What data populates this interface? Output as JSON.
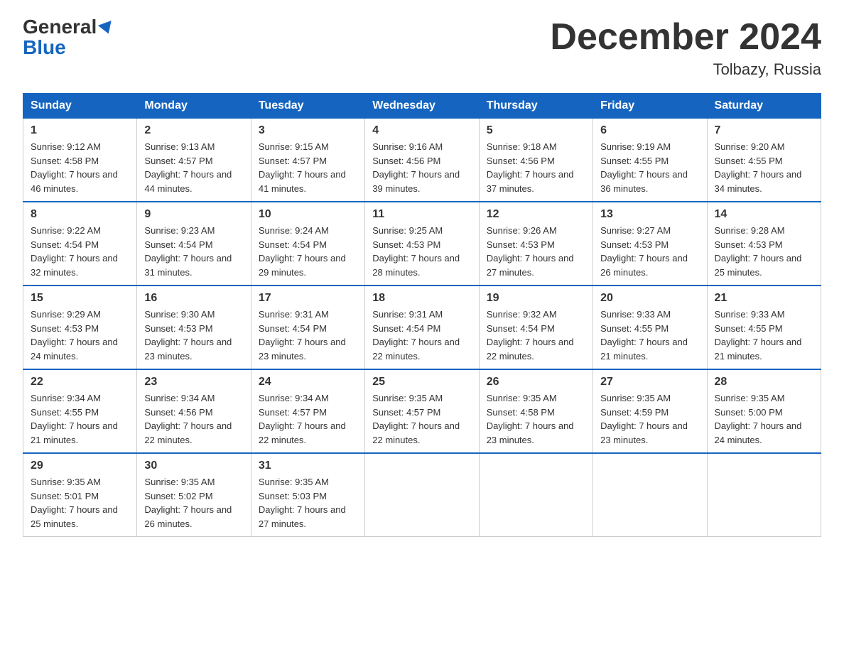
{
  "logo": {
    "line1": "General",
    "line2": "Blue"
  },
  "title": "December 2024",
  "subtitle": "Tolbazy, Russia",
  "weekdays": [
    "Sunday",
    "Monday",
    "Tuesday",
    "Wednesday",
    "Thursday",
    "Friday",
    "Saturday"
  ],
  "weeks": [
    [
      {
        "day": "1",
        "sunrise": "9:12 AM",
        "sunset": "4:58 PM",
        "daylight": "7 hours and 46 minutes."
      },
      {
        "day": "2",
        "sunrise": "9:13 AM",
        "sunset": "4:57 PM",
        "daylight": "7 hours and 44 minutes."
      },
      {
        "day": "3",
        "sunrise": "9:15 AM",
        "sunset": "4:57 PM",
        "daylight": "7 hours and 41 minutes."
      },
      {
        "day": "4",
        "sunrise": "9:16 AM",
        "sunset": "4:56 PM",
        "daylight": "7 hours and 39 minutes."
      },
      {
        "day": "5",
        "sunrise": "9:18 AM",
        "sunset": "4:56 PM",
        "daylight": "7 hours and 37 minutes."
      },
      {
        "day": "6",
        "sunrise": "9:19 AM",
        "sunset": "4:55 PM",
        "daylight": "7 hours and 36 minutes."
      },
      {
        "day": "7",
        "sunrise": "9:20 AM",
        "sunset": "4:55 PM",
        "daylight": "7 hours and 34 minutes."
      }
    ],
    [
      {
        "day": "8",
        "sunrise": "9:22 AM",
        "sunset": "4:54 PM",
        "daylight": "7 hours and 32 minutes."
      },
      {
        "day": "9",
        "sunrise": "9:23 AM",
        "sunset": "4:54 PM",
        "daylight": "7 hours and 31 minutes."
      },
      {
        "day": "10",
        "sunrise": "9:24 AM",
        "sunset": "4:54 PM",
        "daylight": "7 hours and 29 minutes."
      },
      {
        "day": "11",
        "sunrise": "9:25 AM",
        "sunset": "4:53 PM",
        "daylight": "7 hours and 28 minutes."
      },
      {
        "day": "12",
        "sunrise": "9:26 AM",
        "sunset": "4:53 PM",
        "daylight": "7 hours and 27 minutes."
      },
      {
        "day": "13",
        "sunrise": "9:27 AM",
        "sunset": "4:53 PM",
        "daylight": "7 hours and 26 minutes."
      },
      {
        "day": "14",
        "sunrise": "9:28 AM",
        "sunset": "4:53 PM",
        "daylight": "7 hours and 25 minutes."
      }
    ],
    [
      {
        "day": "15",
        "sunrise": "9:29 AM",
        "sunset": "4:53 PM",
        "daylight": "7 hours and 24 minutes."
      },
      {
        "day": "16",
        "sunrise": "9:30 AM",
        "sunset": "4:53 PM",
        "daylight": "7 hours and 23 minutes."
      },
      {
        "day": "17",
        "sunrise": "9:31 AM",
        "sunset": "4:54 PM",
        "daylight": "7 hours and 23 minutes."
      },
      {
        "day": "18",
        "sunrise": "9:31 AM",
        "sunset": "4:54 PM",
        "daylight": "7 hours and 22 minutes."
      },
      {
        "day": "19",
        "sunrise": "9:32 AM",
        "sunset": "4:54 PM",
        "daylight": "7 hours and 22 minutes."
      },
      {
        "day": "20",
        "sunrise": "9:33 AM",
        "sunset": "4:55 PM",
        "daylight": "7 hours and 21 minutes."
      },
      {
        "day": "21",
        "sunrise": "9:33 AM",
        "sunset": "4:55 PM",
        "daylight": "7 hours and 21 minutes."
      }
    ],
    [
      {
        "day": "22",
        "sunrise": "9:34 AM",
        "sunset": "4:55 PM",
        "daylight": "7 hours and 21 minutes."
      },
      {
        "day": "23",
        "sunrise": "9:34 AM",
        "sunset": "4:56 PM",
        "daylight": "7 hours and 22 minutes."
      },
      {
        "day": "24",
        "sunrise": "9:34 AM",
        "sunset": "4:57 PM",
        "daylight": "7 hours and 22 minutes."
      },
      {
        "day": "25",
        "sunrise": "9:35 AM",
        "sunset": "4:57 PM",
        "daylight": "7 hours and 22 minutes."
      },
      {
        "day": "26",
        "sunrise": "9:35 AM",
        "sunset": "4:58 PM",
        "daylight": "7 hours and 23 minutes."
      },
      {
        "day": "27",
        "sunrise": "9:35 AM",
        "sunset": "4:59 PM",
        "daylight": "7 hours and 23 minutes."
      },
      {
        "day": "28",
        "sunrise": "9:35 AM",
        "sunset": "5:00 PM",
        "daylight": "7 hours and 24 minutes."
      }
    ],
    [
      {
        "day": "29",
        "sunrise": "9:35 AM",
        "sunset": "5:01 PM",
        "daylight": "7 hours and 25 minutes."
      },
      {
        "day": "30",
        "sunrise": "9:35 AM",
        "sunset": "5:02 PM",
        "daylight": "7 hours and 26 minutes."
      },
      {
        "day": "31",
        "sunrise": "9:35 AM",
        "sunset": "5:03 PM",
        "daylight": "7 hours and 27 minutes."
      },
      null,
      null,
      null,
      null
    ]
  ]
}
